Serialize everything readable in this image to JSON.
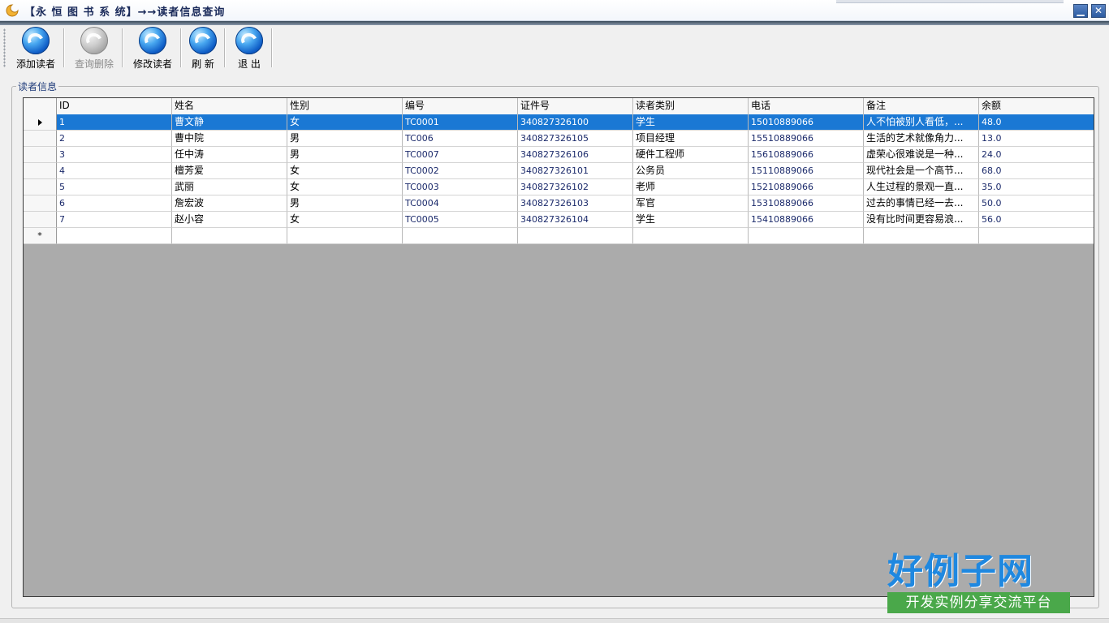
{
  "window": {
    "title": "【永 恒 图 书 系 统】→→读者信息查询",
    "min_glyph": "▁",
    "close_glyph": "✕"
  },
  "toolbar": {
    "buttons": [
      {
        "label": "添加读者",
        "icon": "add-reader-icon",
        "enabled": true
      },
      {
        "label": "查询删除",
        "icon": "query-delete-icon",
        "enabled": false
      },
      {
        "label": "修改读者",
        "icon": "edit-reader-icon",
        "enabled": true
      },
      {
        "label": "刷 新",
        "icon": "refresh-icon",
        "enabled": true
      },
      {
        "label": "退 出",
        "icon": "exit-icon",
        "enabled": true
      }
    ]
  },
  "group": {
    "legend": "读者信息"
  },
  "grid": {
    "columns": [
      "ID",
      "姓名",
      "性别",
      "编号",
      "证件号",
      "读者类别",
      "电话",
      "备注",
      "余额"
    ],
    "rows": [
      [
        "1",
        "曹文静",
        "女",
        "TC0001",
        "340827326100",
        "学生",
        "15010889066",
        "人不怕被别人看低，...",
        "48.0"
      ],
      [
        "2",
        "曹中院",
        "男",
        "TC006",
        "340827326105",
        "项目经理",
        "15510889066",
        "生活的艺术就像角力...",
        "13.0"
      ],
      [
        "3",
        "任中涛",
        "男",
        "TC0007",
        "340827326106",
        "硬件工程师",
        "15610889066",
        "虚荣心很难说是一种...",
        "24.0"
      ],
      [
        "4",
        "檀芳爱",
        "女",
        "TC0002",
        "340827326101",
        "公务员",
        "15110889066",
        "现代社会是一个高节...",
        "68.0"
      ],
      [
        "5",
        "武丽",
        "女",
        "TC0003",
        "340827326102",
        "老师",
        "15210889066",
        "人生过程的景观一直...",
        "35.0"
      ],
      [
        "6",
        "詹宏波",
        "男",
        "TC0004",
        "340827326103",
        "军官",
        "15310889066",
        "过去的事情已经一去...",
        "50.0"
      ],
      [
        "7",
        "赵小容",
        "女",
        "TC0005",
        "340827326104",
        "学生",
        "15410889066",
        "没有比时间更容易浪...",
        "56.0"
      ]
    ],
    "selected_row": 0,
    "new_row_marker": "*"
  },
  "watermark": {
    "logo": "好例子网",
    "tagline": "开发实例分享交流平台"
  },
  "colors": {
    "selection": "#1a78d4",
    "grid_background": "#ababab",
    "logo_blue": "#1f88e0",
    "tag_green": "#4aa84a"
  }
}
